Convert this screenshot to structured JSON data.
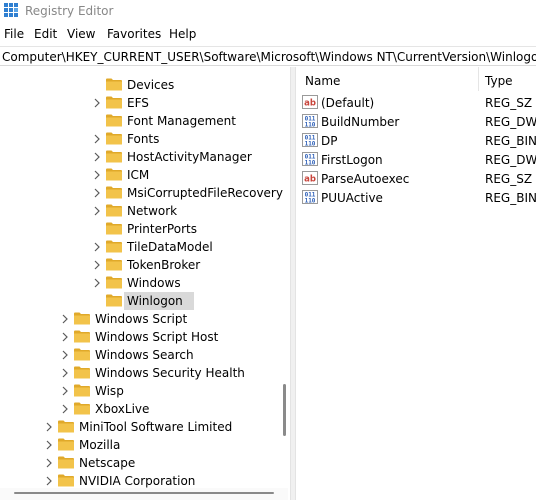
{
  "window": {
    "title": "Registry Editor",
    "icon": "registry-editor-icon"
  },
  "menu": [
    "File",
    "Edit",
    "View",
    "Favorites",
    "Help"
  ],
  "address": "Computer\\HKEY_CURRENT_USER\\Software\\Microsoft\\Windows NT\\CurrentVersion\\Winlogon",
  "tree": {
    "items": [
      {
        "label": "Devices",
        "has_children": false,
        "selected": false
      },
      {
        "label": "EFS",
        "has_children": true,
        "selected": false
      },
      {
        "label": "Font Management",
        "has_children": false,
        "selected": false
      },
      {
        "label": "Fonts",
        "has_children": true,
        "selected": false
      },
      {
        "label": "HostActivityManager",
        "has_children": true,
        "selected": false
      },
      {
        "label": "ICM",
        "has_children": true,
        "selected": false
      },
      {
        "label": "MsiCorruptedFileRecovery",
        "has_children": true,
        "selected": false
      },
      {
        "label": "Network",
        "has_children": true,
        "selected": false
      },
      {
        "label": "PrinterPorts",
        "has_children": false,
        "selected": false
      },
      {
        "label": "TileDataModel",
        "has_children": true,
        "selected": false
      },
      {
        "label": "TokenBroker",
        "has_children": true,
        "selected": false
      },
      {
        "label": "Windows",
        "has_children": true,
        "selected": false
      },
      {
        "label": "Winlogon",
        "has_children": false,
        "selected": true
      },
      {
        "label": "Windows Script",
        "has_children": true,
        "selected": false
      },
      {
        "label": "Windows Script Host",
        "has_children": true,
        "selected": false
      },
      {
        "label": "Windows Search",
        "has_children": true,
        "selected": false
      },
      {
        "label": "Windows Security Health",
        "has_children": true,
        "selected": false
      },
      {
        "label": "Wisp",
        "has_children": true,
        "selected": false
      },
      {
        "label": "XboxLive",
        "has_children": true,
        "selected": false
      },
      {
        "label": "MiniTool Software Limited",
        "has_children": true,
        "selected": false
      },
      {
        "label": "Mozilla",
        "has_children": true,
        "selected": false
      },
      {
        "label": "Netscape",
        "has_children": true,
        "selected": false
      },
      {
        "label": "NVIDIA Corporation",
        "has_children": true,
        "selected": false
      }
    ]
  },
  "list": {
    "columns": [
      "Name",
      "Type"
    ],
    "rows": [
      {
        "name": "(Default)",
        "type": "REG_SZ",
        "icon": "string-value-icon"
      },
      {
        "name": "BuildNumber",
        "type": "REG_DWO",
        "icon": "binary-value-icon"
      },
      {
        "name": "DP",
        "type": "REG_BINA",
        "icon": "binary-value-icon"
      },
      {
        "name": "FirstLogon",
        "type": "REG_DWO",
        "icon": "binary-value-icon"
      },
      {
        "name": "ParseAutoexec",
        "type": "REG_SZ",
        "icon": "string-value-icon"
      },
      {
        "name": "PUUActive",
        "type": "REG_BINA",
        "icon": "binary-value-icon"
      }
    ]
  },
  "colors": {
    "folder": "#f2c34a",
    "folder_dark": "#e0a92a",
    "selection": "#d9d9d9",
    "string_icon": "#c8453c",
    "binary_icon": "#2d5fb7"
  }
}
